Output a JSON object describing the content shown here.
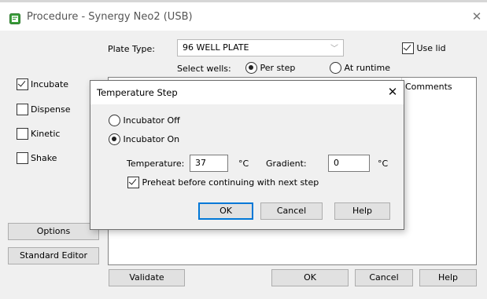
{
  "window": {
    "title": "Procedure - Synergy Neo2 (USB)",
    "close_glyph": "✕",
    "app_icon": "procedure-app-icon"
  },
  "plate": {
    "type_label": "Plate Type:",
    "type_value": "96 WELL PLATE",
    "dropdown_glyph": "﹀",
    "use_lid_label": "Use lid",
    "use_lid_checked": true,
    "select_wells_label": "Select wells:",
    "per_step_label": "Per step",
    "at_runtime_label": "At runtime",
    "select_wells_mode": "Per step"
  },
  "sidebar": {
    "items": [
      {
        "label": "Incubate",
        "checked": true
      },
      {
        "label": "Dispense",
        "checked": false
      },
      {
        "label": "Kinetic",
        "checked": false
      },
      {
        "label": "Shake",
        "checked": false
      }
    ],
    "options_label": "Options",
    "standard_editor_label": "Standard Editor"
  },
  "steps": {
    "comments_header": "Comments"
  },
  "bottom": {
    "validate_label": "Validate",
    "ok_label": "OK",
    "cancel_label": "Cancel",
    "help_label": "Help"
  },
  "modal": {
    "title": "Temperature Step",
    "close_glyph": "✕",
    "incubator_off_label": "Incubator Off",
    "incubator_on_label": "Incubator On",
    "incubator_state": "on",
    "temperature_label": "Temperature:",
    "temperature_value": "37",
    "temperature_unit": "°C",
    "gradient_label": "Gradient:",
    "gradient_value": "0",
    "gradient_unit": "°C",
    "preheat_label": "Preheat before continuing with next step",
    "preheat_checked": true,
    "ok_label": "OK",
    "cancel_label": "Cancel",
    "help_label": "Help"
  },
  "colors": {
    "default_button_border": "#0078d7",
    "dialog_background": "#f0f0f0"
  }
}
